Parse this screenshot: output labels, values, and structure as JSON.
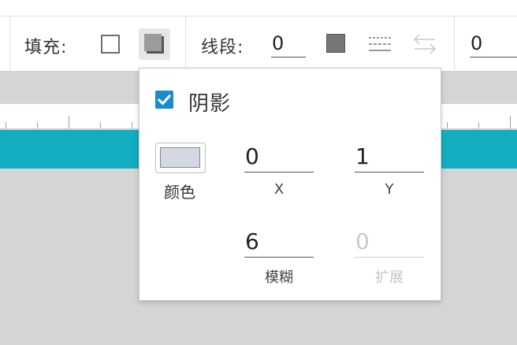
{
  "toolbar": {
    "fill_label": "填充:",
    "stroke_label": "线段:",
    "stroke_width": "0",
    "extra_value": "0"
  },
  "shadow_popup": {
    "checkbox_label": "阴影",
    "checked": true,
    "color_label": "颜色",
    "color_value": "#d4d7e4",
    "x_value": "0",
    "x_label": "X",
    "y_value": "1",
    "y_label": "Y",
    "blur_value": "6",
    "blur_label": "模糊",
    "spread_value": "0",
    "spread_label": "扩展",
    "spread_disabled": true
  },
  "colors": {
    "accent_teal": "#12adc0",
    "checkbox_blue": "#1a8cc8"
  },
  "icons": [
    "fill-none-icon",
    "fill-shadow-icon",
    "stroke-color-icon",
    "dash-style-icon",
    "swap-arrows-icon",
    "checkmark-icon"
  ]
}
